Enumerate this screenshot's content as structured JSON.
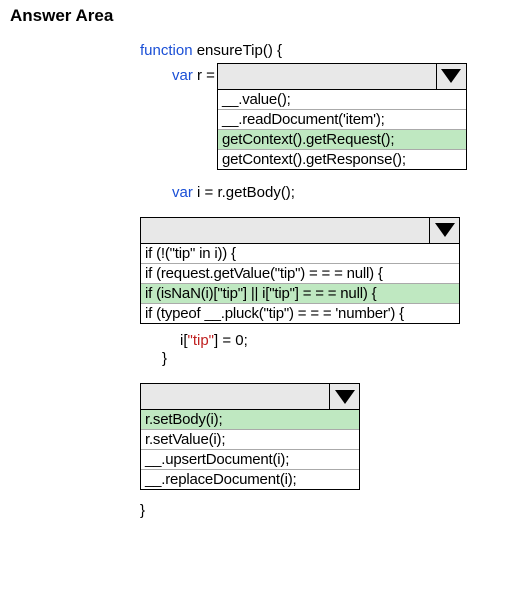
{
  "title": "Answer Area",
  "code": {
    "fn": "function",
    "fn_name": " ensureTip() {",
    "var_kw": "var",
    "r_eq": " r = ",
    "i_eq": " i = r.getBody();",
    "tip_assign_pre": "i[",
    "tip_assign_str": "\"tip\"",
    "tip_assign_post": "] = 0;",
    "brace_close": "}"
  },
  "dd1": {
    "opts": [
      "__.value();",
      "__.readDocument('item');",
      "getContext().getRequest();",
      "getContext().getResponse();"
    ],
    "selected": 2
  },
  "dd2": {
    "opts": [
      "if (!(\"tip\" in i)) {",
      "if (request.getValue(\"tip\") = = = null) {",
      "if (isNaN(i)[\"tip\"] || i[\"tip\"] = = = null) {",
      "if (typeof __.pluck(\"tip\") = = = 'number') {"
    ],
    "selected": 2
  },
  "dd3": {
    "opts": [
      "r.setBody(i);",
      "r.setValue(i);",
      "__.upsertDocument(i);",
      "__.replaceDocument(i);"
    ],
    "selected": 0
  }
}
